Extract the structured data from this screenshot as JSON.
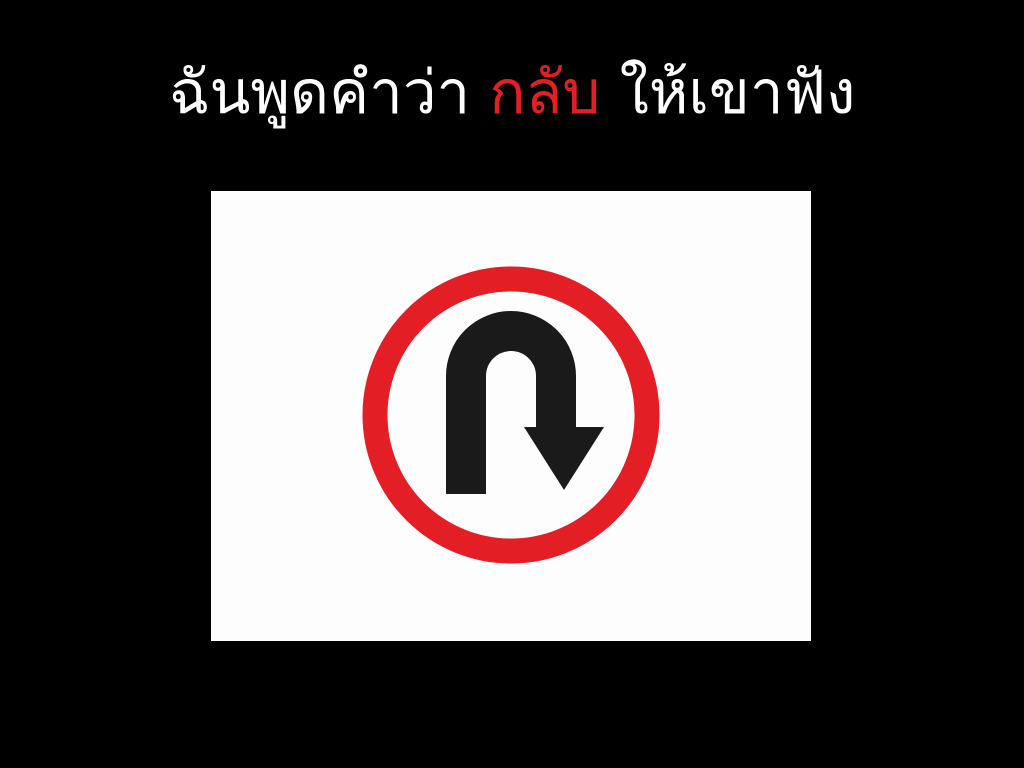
{
  "slide": {
    "title_before": "ฉันพูดคำว่า",
    "title_highlight": "กลับ",
    "title_after": "ให้เขาฟัง"
  },
  "sign": {
    "icon": "u-turn-icon",
    "ring_color": "#e41e25",
    "arrow_color": "#1a1a1a",
    "background_color": "#fdfdfd"
  },
  "colors": {
    "background": "#000000",
    "title_text": "#ffffff",
    "highlight_text": "#e41e25"
  }
}
